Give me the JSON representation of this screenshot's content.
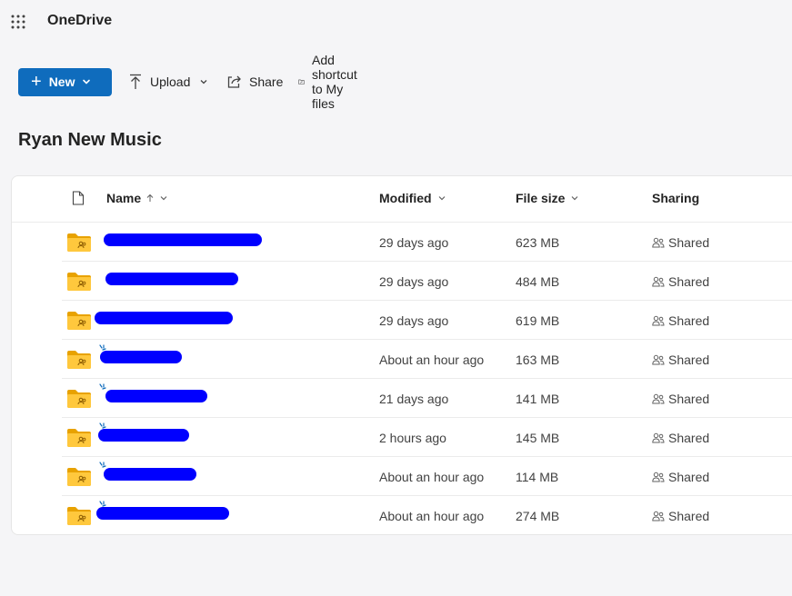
{
  "app": {
    "title": "OneDrive"
  },
  "toolbar": {
    "new_label": "New",
    "upload_label": "Upload",
    "share_label": "Share",
    "shortcut_label": "Add shortcut to My files"
  },
  "page": {
    "title": "Ryan New Music"
  },
  "table": {
    "columns": {
      "name": "Name",
      "modified": "Modified",
      "size": "File size",
      "sharing": "Sharing"
    },
    "rows": [
      {
        "modified": "29 days ago",
        "size": "623 MB",
        "sharing": "Shared",
        "new_badge": false
      },
      {
        "modified": "29 days ago",
        "size": "484 MB",
        "sharing": "Shared",
        "new_badge": false
      },
      {
        "modified": "29 days ago",
        "size": "619 MB",
        "sharing": "Shared",
        "new_badge": false
      },
      {
        "modified": "About an hour ago",
        "size": "163 MB",
        "sharing": "Shared",
        "new_badge": true
      },
      {
        "modified": "21 days ago",
        "size": "141 MB",
        "sharing": "Shared",
        "new_badge": true
      },
      {
        "modified": "2 hours ago",
        "size": "145 MB",
        "sharing": "Shared",
        "new_badge": true
      },
      {
        "modified": "About an hour ago",
        "size": "114 MB",
        "sharing": "Shared",
        "new_badge": true
      },
      {
        "modified": "About an hour ago",
        "size": "274 MB",
        "sharing": "Shared",
        "new_badge": true
      }
    ]
  },
  "colors": {
    "accent": "#0f6cbd",
    "folder": "#ffb900",
    "redaction": "#0000ff"
  },
  "icons": [
    "waffle-icon",
    "plus-icon",
    "chevron-down-icon",
    "upload-icon",
    "share-icon",
    "shortcut-icon",
    "file-icon",
    "sort-up-icon",
    "shared-folder-icon",
    "new-badge-icon",
    "people-icon"
  ]
}
